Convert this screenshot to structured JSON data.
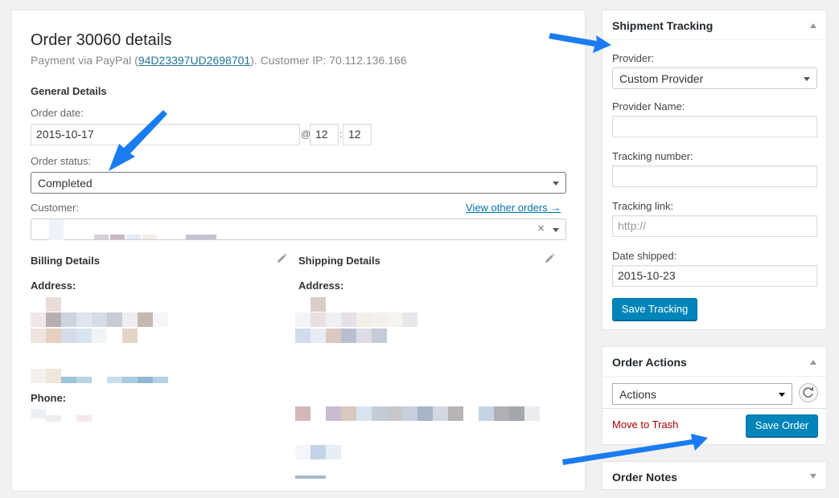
{
  "order": {
    "title": "Order 30060 details",
    "payment_prefix": "Payment via PayPal (",
    "transaction_id": "94D23397UD2698701",
    "payment_suffix": "). Customer IP: 70.112.136.166",
    "general_details_heading": "General Details",
    "order_date_label": "Order date:",
    "order_date_value": "2015-10-17",
    "at_sign": "@",
    "hour_value": "12",
    "time_sep": ":",
    "minute_value": "12",
    "order_status_label": "Order status:",
    "order_status_value": "Completed",
    "customer_label": "Customer:",
    "view_other_orders": "View other orders →",
    "clear_symbol": "×",
    "billing_heading": "Billing Details",
    "shipping_heading": "Shipping Details",
    "address_label": "Address:",
    "phone_label": "Phone:"
  },
  "tracking": {
    "title": "Shipment Tracking",
    "provider_label": "Provider:",
    "provider_value": "Custom Provider",
    "provider_name_label": "Provider Name:",
    "provider_name_value": "",
    "tracking_number_label": "Tracking number:",
    "tracking_number_value": "",
    "tracking_link_label": "Tracking link:",
    "tracking_link_placeholder": "http://",
    "date_shipped_label": "Date shipped:",
    "date_shipped_value": "2015-10-23",
    "save_button": "Save Tracking"
  },
  "actions": {
    "title": "Order Actions",
    "select_value": "Actions",
    "move_to_trash": "Move to Trash",
    "save_order": "Save Order"
  },
  "notes": {
    "title": "Order Notes"
  },
  "colors": {
    "accent": "#0085ba",
    "link": "#0073aa",
    "trash": "#aa0000",
    "annotation_arrow": "#1a7cf0"
  },
  "icons": [
    "pencil-icon",
    "refresh-icon",
    "chevron-down-icon",
    "chevron-up-icon",
    "arrow-annotation-icon"
  ]
}
